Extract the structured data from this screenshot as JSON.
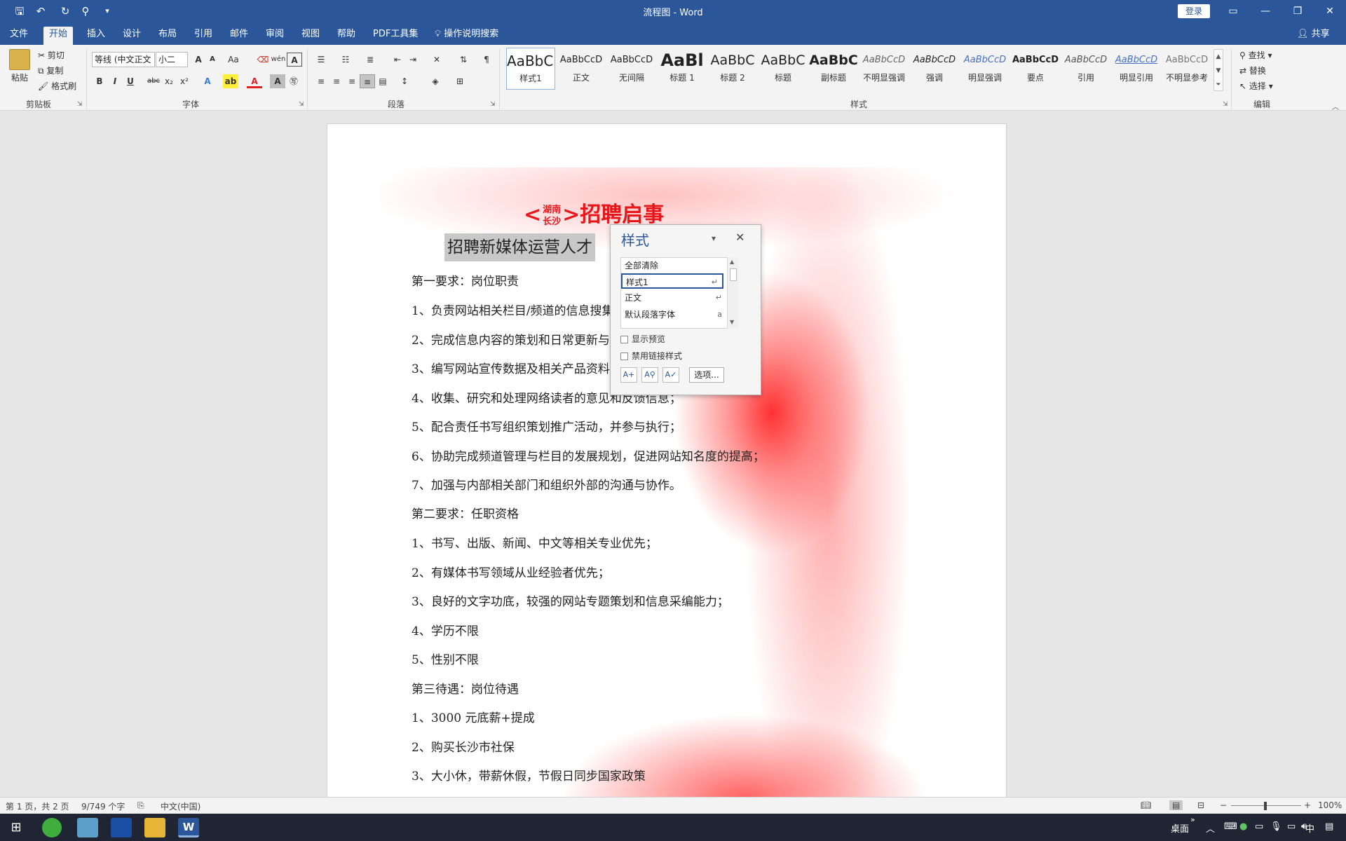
{
  "window": {
    "title": "流程图 - Word",
    "login_label": "登录",
    "qat": [
      "save-icon",
      "undo-icon",
      "redo-icon",
      "touch-icon"
    ]
  },
  "tabs": [
    "文件",
    "开始",
    "插入",
    "设计",
    "布局",
    "引用",
    "邮件",
    "审阅",
    "视图",
    "帮助",
    "PDF工具集"
  ],
  "tell_me": "操作说明搜索",
  "share_label": "共享",
  "ribbon": {
    "clipboard": {
      "group": "剪贴板",
      "paste": "粘贴",
      "cut": "剪切",
      "copy": "复制",
      "painter": "格式刷"
    },
    "font": {
      "group": "字体",
      "font_name": "等线 (中文正文",
      "font_size": "小二",
      "bold": "B",
      "italic": "I",
      "underline": "U",
      "strike": "abc",
      "sub": "x₂",
      "sup": "x²",
      "change_case": "Aa",
      "grow": "A",
      "shrink": "A",
      "phonetic": "wén",
      "border_a": "A"
    },
    "paragraph": {
      "group": "段落"
    },
    "styles": {
      "group": "样式",
      "items": [
        {
          "preview": "AaBbC(",
          "name": "样式1"
        },
        {
          "preview": "AaBbCcD",
          "name": "正文"
        },
        {
          "preview": "AaBbCcD",
          "name": "无间隔"
        },
        {
          "preview": "AaBl",
          "name": "标题 1"
        },
        {
          "preview": "AaBbC",
          "name": "标题 2"
        },
        {
          "preview": "AaBbC",
          "name": "标题"
        },
        {
          "preview": "AaBbC",
          "name": "副标题"
        },
        {
          "preview": "AaBbCcD",
          "name": "不明显强调"
        },
        {
          "preview": "AaBbCcD",
          "name": "强调"
        },
        {
          "preview": "AaBbCcD",
          "name": "明显强调"
        },
        {
          "preview": "AaBbCcD",
          "name": "要点"
        },
        {
          "preview": "AaBbCcD",
          "name": "引用"
        },
        {
          "preview": "AaBbCcD",
          "name": "明显引用"
        },
        {
          "preview": "AaBbCcD",
          "name": "不明显参考"
        }
      ]
    },
    "editing": {
      "group": "编辑",
      "find": "查找",
      "replace": "替换",
      "select": "选择"
    }
  },
  "document": {
    "headline_left": "<",
    "headline_top": "湖南",
    "headline_bottom": "长沙",
    "headline_right": ">招聘启事",
    "subheading": "招聘新媒体运营人才",
    "lines": [
      "第一要求：岗位职责",
      "1、负责网站相关栏目/频道的信息搜集、编辑、审校等工作；",
      "2、完成信息内容的策划和日常更新与维护；",
      "3、编写网站宣传数据及相关产品资料；",
      "4、收集、研究和处理网络读者的意见和反馈信息；",
      "5、配合责任书写组织策划推广活动，并参与执行；",
      "6、协助完成频道管理与栏目的发展规划，促进网站知名度的提高；",
      "7、加强与内部相关部门和组织外部的沟通与协作。",
      "第二要求：任职资格",
      "1、书写、出版、新闻、中文等相关专业优先；",
      "2、有媒体书写领域从业经验者优先；",
      "3、良好的文字功底，较强的网站专题策划和信息采编能力；",
      "4、学历不限",
      "5、性别不限",
      "第三待遇：岗位待遇",
      "1、3000 元底薪+提成",
      "2、购买长沙市社保",
      "3、大小休，带薪休假，节假日同步国家政策"
    ]
  },
  "styles_pane": {
    "title": "样式",
    "items": [
      {
        "name": "全部清除",
        "mark": ""
      },
      {
        "name": "样式1",
        "mark": "↵"
      },
      {
        "name": "正文",
        "mark": "↵"
      },
      {
        "name": "默认段落字体",
        "mark": "a"
      }
    ],
    "show_preview": "显示预览",
    "disable_linked": "禁用链接样式",
    "options": "选项..."
  },
  "status": {
    "page": "第 1 页，共 2 页",
    "words": "9/749 个字",
    "language": "中文(中国)",
    "zoom": "100%"
  },
  "taskbar": {
    "desktop": "桌面",
    "ime": "中"
  }
}
